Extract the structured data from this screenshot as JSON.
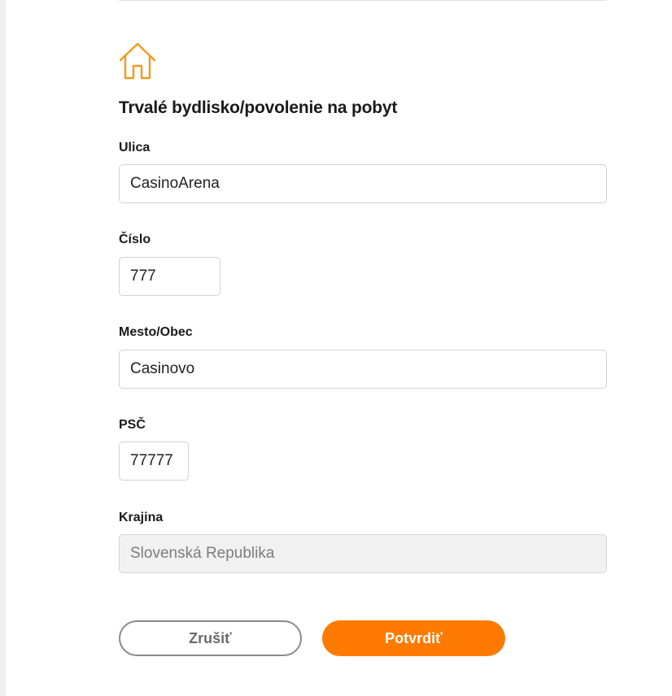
{
  "section": {
    "icon": "home-icon",
    "title": "Trvalé bydlisko/povolenie na pobyt"
  },
  "fields": {
    "street": {
      "label": "Ulica",
      "value": "CasinoArena"
    },
    "number": {
      "label": "Číslo",
      "value": "777"
    },
    "city": {
      "label": "Mesto/Obec",
      "value": "Casinovo"
    },
    "zip": {
      "label": "PSČ",
      "value": "77777"
    },
    "country": {
      "label": "Krajina",
      "value": "Slovenská Republika",
      "disabled": true
    }
  },
  "actions": {
    "cancel_label": "Zrušiť",
    "confirm_label": "Potvrdiť"
  },
  "colors": {
    "accent": "#ff7a00",
    "icon_stroke": "#f39a1c",
    "disabled_field": "#f1f1f1"
  }
}
